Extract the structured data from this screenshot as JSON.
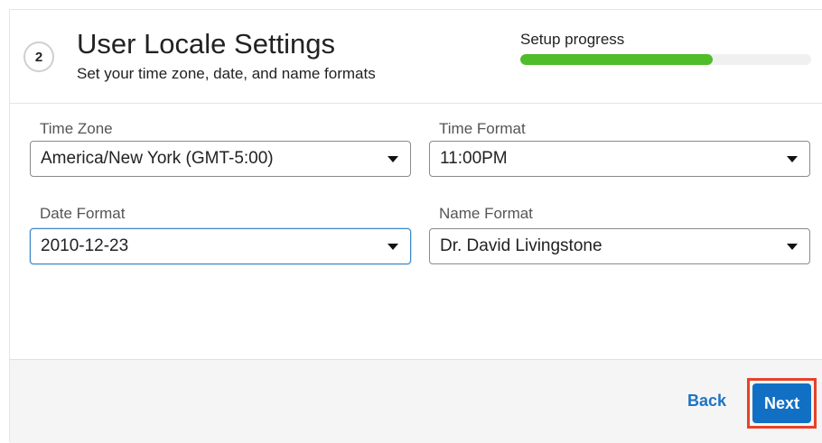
{
  "header": {
    "step_number": "2",
    "title": "User Locale Settings",
    "subtitle": "Set your time zone, date, and name formats",
    "progress_label": "Setup progress",
    "progress_fraction": 0.66,
    "progress_color": "#4fbc2a"
  },
  "form": {
    "time_zone": {
      "label": "Time Zone",
      "value": "America/New York (GMT-5:00)"
    },
    "time_format": {
      "label": "Time Format",
      "value": "11:00PM"
    },
    "date_format": {
      "label": "Date Format",
      "value": "2010-12-23"
    },
    "name_format": {
      "label": "Name Format",
      "value": "Dr. David Livingstone"
    }
  },
  "footer": {
    "back_label": "Back",
    "next_label": "Next",
    "accent_color": "#1270c4",
    "highlight_color": "#e8412a"
  }
}
